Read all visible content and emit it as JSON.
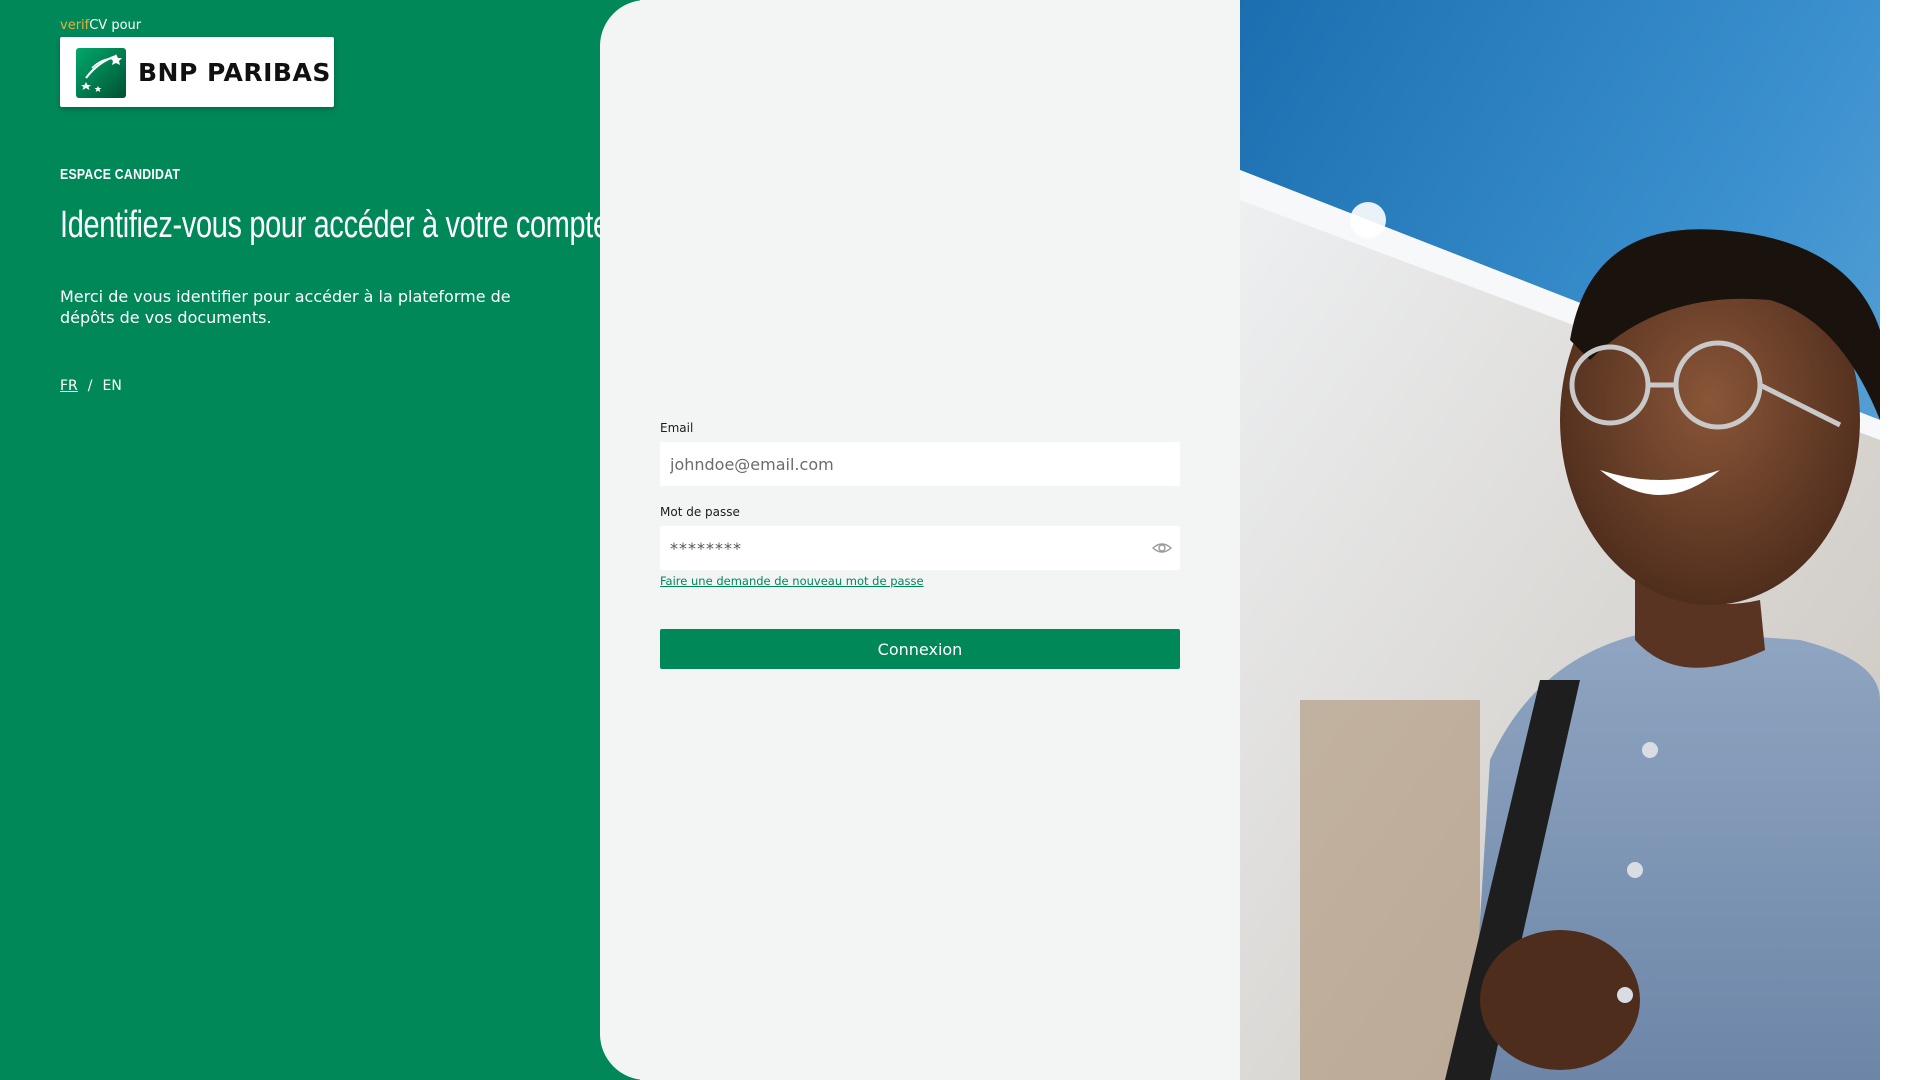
{
  "brand": {
    "prefix_verif": "verif",
    "prefix_cv": "CV pour",
    "logo_text": "BNP PARIBAS",
    "logo_icon": "bnp-stars-icon"
  },
  "left": {
    "kicker": "ESPACE CANDIDAT",
    "headline": "Identifiez-vous pour accéder à votre compte",
    "intro": "Merci de vous identifier pour accéder à la plateforme de dépôts de vos documents.",
    "lang": {
      "active": "FR",
      "separator": "/",
      "other": "EN"
    }
  },
  "form": {
    "email_label": "Email",
    "email_placeholder": "johndoe@email.com",
    "password_label": "Mot de passe",
    "password_placeholder": "********",
    "password_toggle_icon": "eye-icon",
    "forgot_link": "Faire une demande de nouveau mot de passe",
    "submit_label": "Connexion"
  },
  "colors": {
    "brand_green": "#008859",
    "panel_bg": "#f2f5f4",
    "verif_accent": "#e9b13b"
  },
  "photo": {
    "icon": "smiling-man-photo"
  }
}
